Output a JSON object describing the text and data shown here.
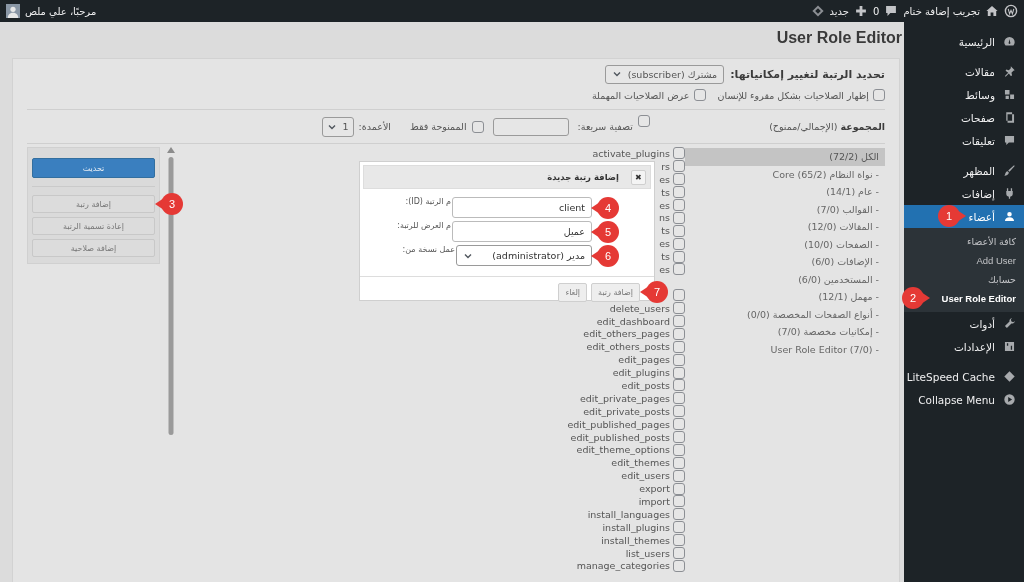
{
  "admin_bar": {
    "site_name": "تجريب إضافة ختام",
    "comments_count": "0",
    "new_label": "جديد",
    "greeting": "مرحبًا، علي ملص"
  },
  "sidebar": {
    "groups": [
      [
        {
          "label": "الرئيسية",
          "selected": false
        }
      ],
      [
        {
          "label": "مقالات",
          "selected": false
        },
        {
          "label": "وسائط",
          "selected": false
        },
        {
          "label": "صفحات",
          "selected": false
        },
        {
          "label": "تعليقات",
          "selected": false
        }
      ],
      [
        {
          "label": "المظهر",
          "selected": false
        },
        {
          "label": "إضافات",
          "selected": false
        },
        {
          "label": "أعضاء",
          "selected": true,
          "callout": "1",
          "children": [
            {
              "label": "كافة الأعضاء",
              "selected": false
            },
            {
              "label": "Add User",
              "selected": false
            },
            {
              "label": "حسابك",
              "selected": false
            },
            {
              "label": "User Role Editor",
              "selected": true,
              "callout": "2"
            }
          ]
        },
        {
          "label": "أدوات",
          "selected": false
        },
        {
          "label": "الإعدادات",
          "selected": false
        }
      ],
      [
        {
          "label": "LiteSpeed Cache",
          "selected": false
        },
        {
          "label": "Collapse Menu",
          "selected": false
        }
      ]
    ]
  },
  "page": {
    "title": "User Role Editor",
    "role_label": "تحديد الرتبة لتغيير إمكانياتها:",
    "role_select": "مشترك (subscriber)",
    "options": [
      {
        "label": "إظهار الصلاحيات بشكل مقروء للإنسان",
        "checked": false
      },
      {
        "label": "عرض الصلاحيات المهملة",
        "checked": false
      }
    ],
    "toolbar": {
      "group_heading": "**المجموعة** (الإجمالي/ممنوح)",
      "quick_filter_label": "تصفية سريعة:",
      "quick_filter_checked": false,
      "granted_only_label": "الممنوحة فقط",
      "granted_only_checked": false,
      "columns_label": "الأعمدة:",
      "columns_value": "1"
    }
  },
  "groups": [
    {
      "label": "الكل (72/2)",
      "selected": true
    },
    {
      "label": "- نواة النظام Core (65/2)",
      "selected": false
    },
    {
      "label": "- عام (14/1)",
      "selected": false
    },
    {
      "label": "- القوالب (7/0)",
      "selected": false
    },
    {
      "label": "- المقالات (12/0)",
      "selected": false
    },
    {
      "label": "- الصفحات (10/0)",
      "selected": false
    },
    {
      "label": "- الإضافات (6/0)",
      "selected": false
    },
    {
      "label": "- المستخدمين (6/0)",
      "selected": false
    },
    {
      "label": "- مهمل (12/1)",
      "selected": false
    },
    {
      "label": "- أنواع الصفحات المخصصة (0/0)",
      "selected": false
    },
    {
      "label": "- إمكانيات مخصصة (7/0)",
      "selected": false
    },
    {
      "label": "- User Role Editor (7/0)",
      "selected": false
    }
  ],
  "capabilities": [
    {
      "label": "activate_plugins",
      "checked": false
    },
    {
      "label": "rs",
      "checked": false
    },
    {
      "label": "es",
      "checked": false
    },
    {
      "label": "ts",
      "checked": false
    },
    {
      "label": "es",
      "checked": false
    },
    {
      "label": "ns",
      "checked": false
    },
    {
      "label": "ts",
      "checked": false
    },
    {
      "label": "es",
      "checked": false
    },
    {
      "label": "ts",
      "checked": false
    },
    {
      "label": "es",
      "checked": false
    },
    {
      "checked": false
    },
    {
      "label": "delete_users",
      "checked": false
    },
    {
      "label": "edit_dashboard",
      "checked": false
    },
    {
      "label": "edit_others_pages",
      "checked": false
    },
    {
      "label": "edit_others_posts",
      "checked": false
    },
    {
      "label": "edit_pages",
      "checked": false
    },
    {
      "label": "edit_plugins",
      "checked": false
    },
    {
      "label": "edit_posts",
      "checked": false
    },
    {
      "label": "edit_private_pages",
      "checked": false
    },
    {
      "label": "edit_private_posts",
      "checked": false
    },
    {
      "label": "edit_published_pages",
      "checked": false
    },
    {
      "label": "edit_published_posts",
      "checked": false
    },
    {
      "label": "edit_theme_options",
      "checked": false
    },
    {
      "label": "edit_themes",
      "checked": false
    },
    {
      "label": "edit_users",
      "checked": false
    },
    {
      "label": "export",
      "checked": false
    },
    {
      "label": "import",
      "checked": false
    },
    {
      "label": "install_languages",
      "checked": false
    },
    {
      "label": "install_plugins",
      "checked": false
    },
    {
      "label": "install_themes",
      "checked": false
    },
    {
      "label": "list_users",
      "checked": false
    },
    {
      "label": "manage_categories",
      "checked": false
    }
  ],
  "actions": [
    {
      "label": "تحديث",
      "kind": "primary"
    },
    {
      "label": "إضافة رتبة",
      "kind": "secondary",
      "callout": "3"
    },
    {
      "label": "إعادة تسمية الرتبة",
      "kind": "secondary"
    },
    {
      "label": "إضافة صلاحية",
      "kind": "secondary"
    }
  ],
  "dialog": {
    "title": "إضافة رتبة جديدة",
    "close_glyph": "✖",
    "fields": [
      {
        "label": "م الرتبة (ID):",
        "kind": "text",
        "value": "client",
        "callout": "4"
      },
      {
        "label": "م العرض للرتبة:",
        "kind": "text",
        "value": "عميل",
        "callout": "5"
      },
      {
        "label": "عمل نسخة من:",
        "kind": "select",
        "value": "مدير (administrator)",
        "callout": "6"
      }
    ],
    "buttons": [
      {
        "label": "إضافة رتبة",
        "callout": "7"
      },
      {
        "label": "إلغاء"
      }
    ]
  }
}
